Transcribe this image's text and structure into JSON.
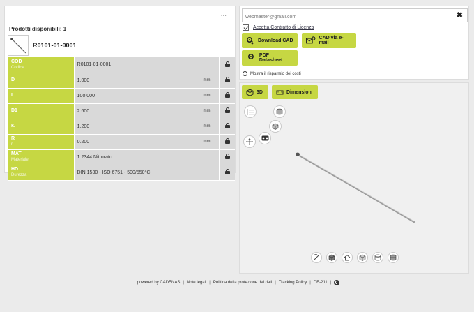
{
  "left": {
    "menu_glyph": "...",
    "products_label": "Prodotti disponibili: 1",
    "product_code": "R0101-01-0001",
    "rows": [
      {
        "key": "COD",
        "desc": "Codice",
        "value": "R0101-01-0001",
        "unit": ""
      },
      {
        "key": "D",
        "desc": "",
        "value": "1.000",
        "unit": "mm"
      },
      {
        "key": "L",
        "desc": "",
        "value": "100.000",
        "unit": "mm"
      },
      {
        "key": "D1",
        "desc": "",
        "value": "2.600",
        "unit": "mm"
      },
      {
        "key": "K",
        "desc": "",
        "value": "1.200",
        "unit": "mm"
      },
      {
        "key": "R",
        "desc": "r",
        "value": "0.200",
        "unit": "mm"
      },
      {
        "key": "MAT",
        "desc": "Materiale",
        "value": "1.2344 Nitrurato",
        "unit": ""
      },
      {
        "key": "HD",
        "desc": "Durezza",
        "value": "DIN 1530 - ISO 6751 - 500/550°C",
        "unit": ""
      }
    ]
  },
  "right": {
    "email_placeholder": "webmaster@gmail.com",
    "clear_glyph": "✖",
    "accept_label": "Accetta Contratto di Licenza",
    "accept_checked": true,
    "download_cad": "Download CAD",
    "cad_email": "CAD via e-mail",
    "pdf_datasheet": "PDF Datasheet",
    "pdf_badge": "PDF",
    "savings_label": "Mostra il risparmio dei costi"
  },
  "viewer": {
    "btn_3d": "3D",
    "btn_dimension": "Dimension"
  },
  "footer": {
    "powered": "powered by CADENAS",
    "legal": "Note legali",
    "privacy": "Politica della protezione dei dati",
    "tracking": "Tracking Policy",
    "version": "DE-211",
    "sep": "|"
  },
  "colors": {
    "accent": "#c6d743",
    "cell_bg": "#d9d9d9",
    "page_bg": "#ebebeb"
  }
}
